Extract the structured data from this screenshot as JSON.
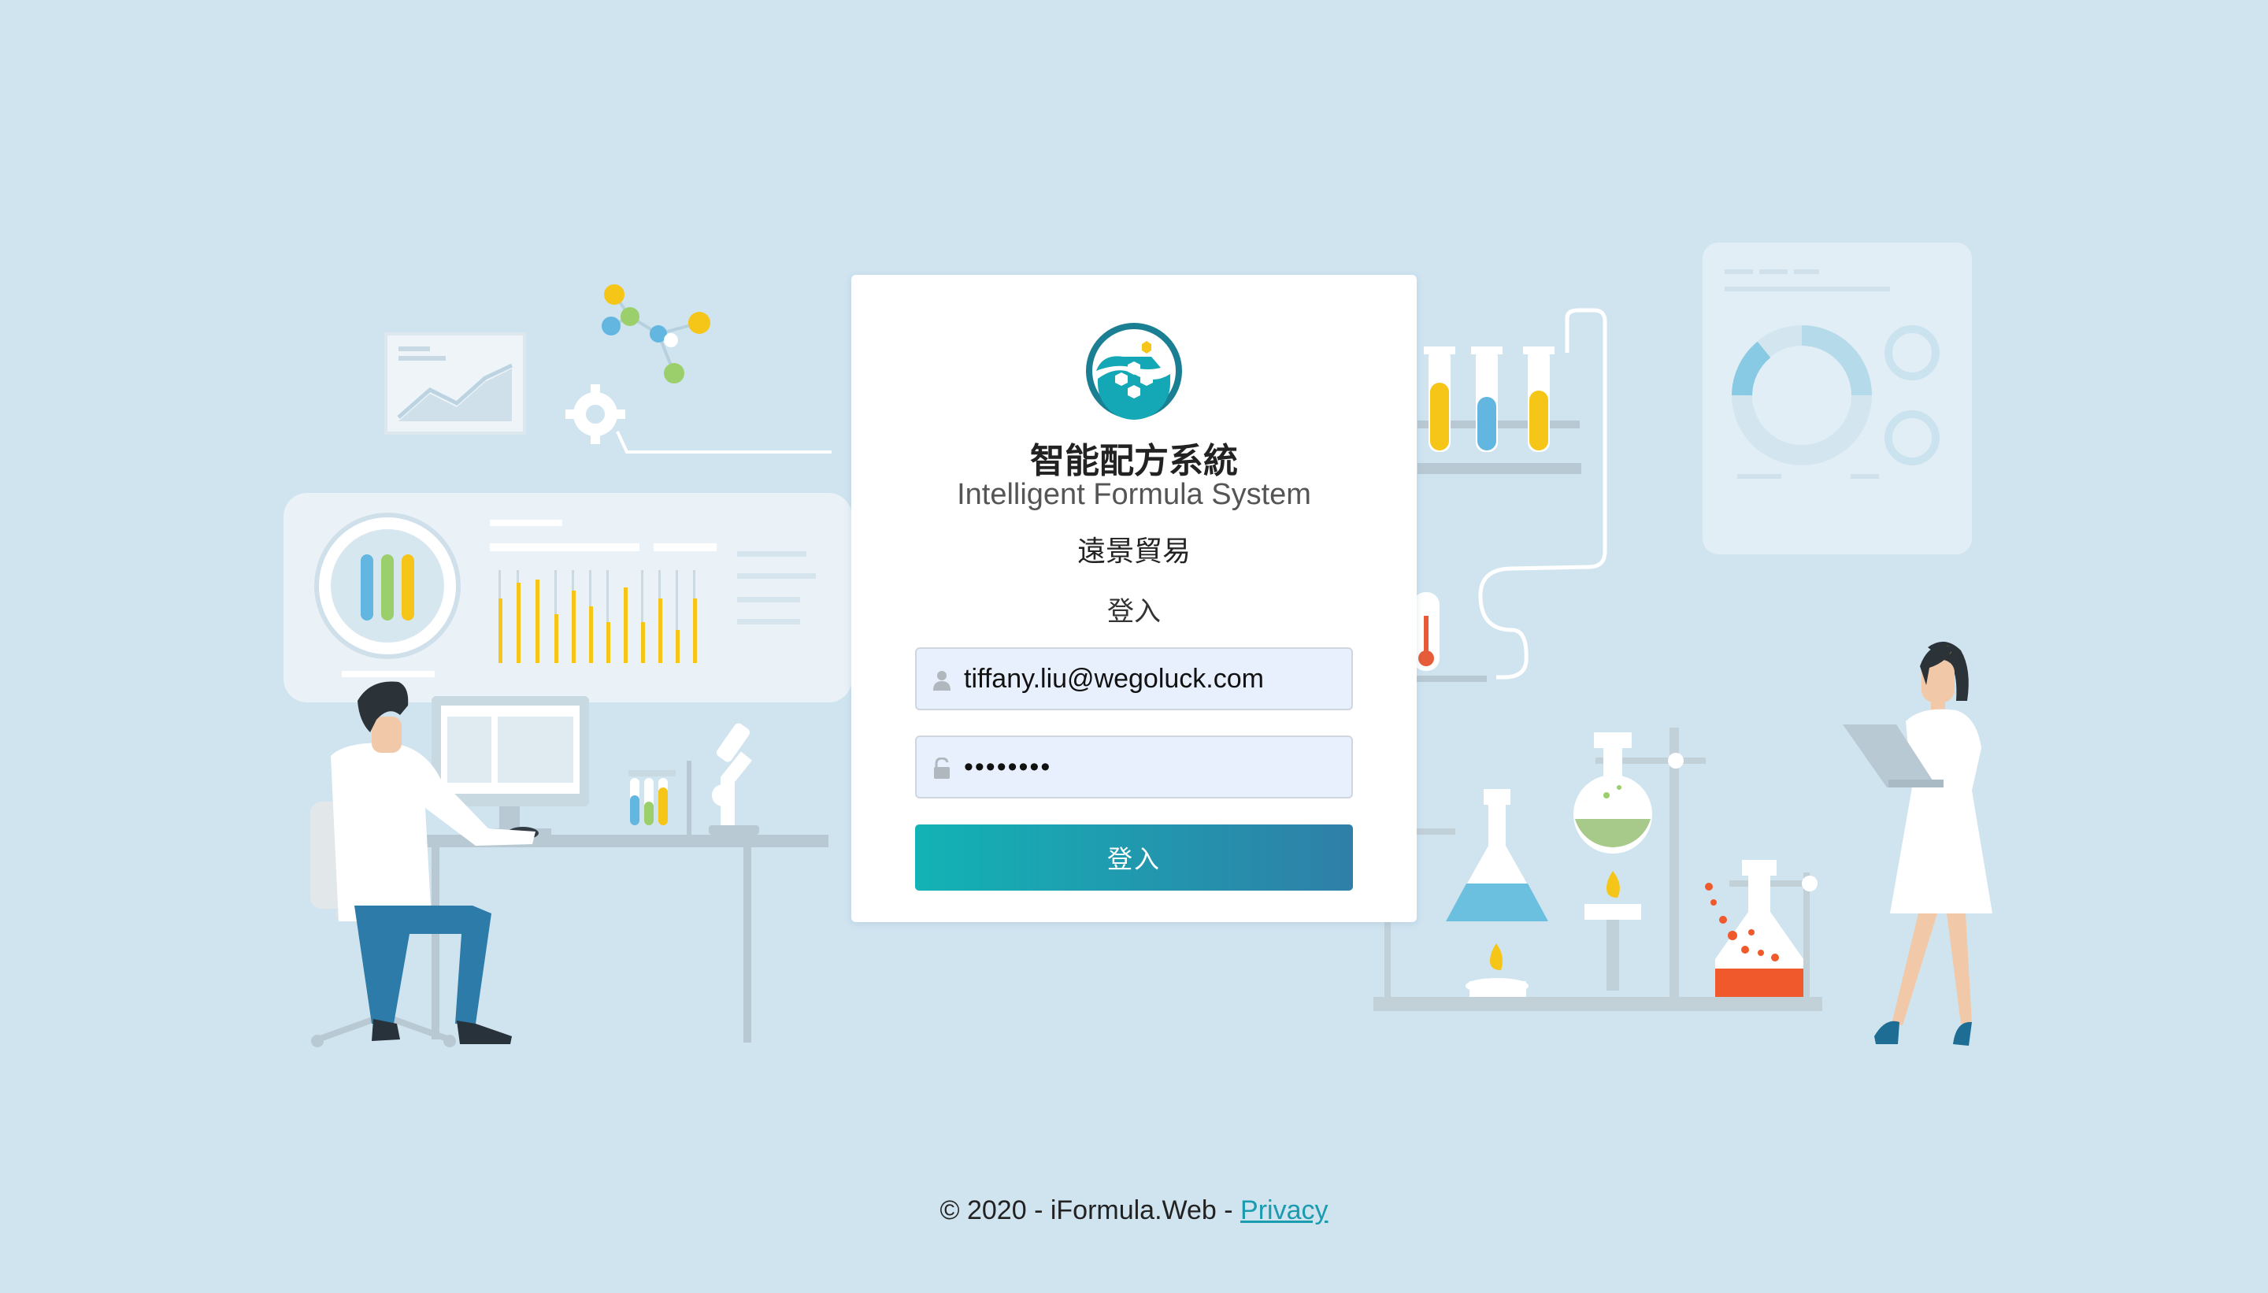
{
  "app": {
    "title_zh": "智能配方系統",
    "title_en": "Intelligent Formula System",
    "company": "遠景貿易",
    "logo_icon": "flask-hexagon-logo"
  },
  "login": {
    "heading": "登入",
    "email_value": "tiffany.liu@wegoluck.com",
    "password_value": "tiffanyL",
    "submit_label": "登入",
    "user_icon": "user-icon",
    "lock_icon": "lock-icon"
  },
  "footer": {
    "copyright": "© 2020 - iFormula.Web - ",
    "privacy_label": "Privacy"
  },
  "colors": {
    "background": "#d0e4f0",
    "accent_start": "#12b3b5",
    "accent_end": "#2f7fa8",
    "link": "#1a9bb0"
  }
}
